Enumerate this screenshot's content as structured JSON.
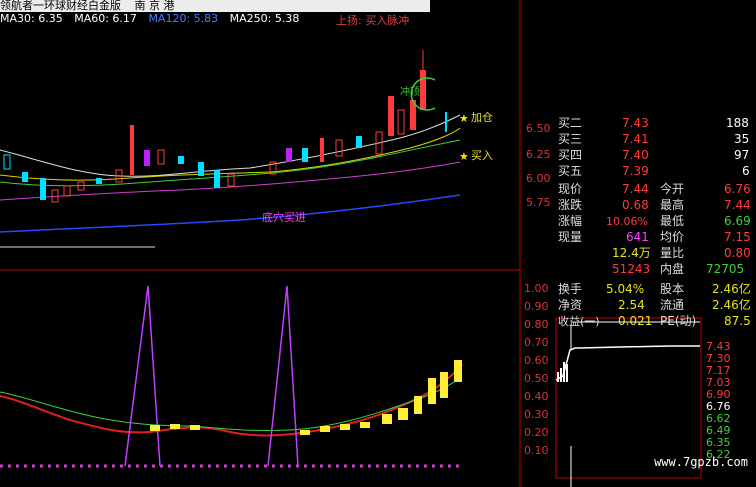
{
  "header": {
    "title": "领航者一环球财经白金版",
    "exchanges": "南 京 港",
    "signal": "上扬: 买入脉冲"
  },
  "ma": [
    {
      "label": "MA30: 6.35",
      "color": "#ffffff"
    },
    {
      "label": "MA60: 6.17",
      "color": "#ffffff"
    },
    {
      "label": "MA120: 5.83",
      "color": "#4a7dff"
    },
    {
      "label": "MA250: 5.38",
      "color": "#ffffff"
    }
  ],
  "annotations": {
    "add_position": "加仓",
    "buy": "买入",
    "bottom_buy": "底穴买进",
    "pulse": "冲顶"
  },
  "price_axis": [
    "6.50",
    "6.25",
    "6.00",
    "5.75"
  ],
  "indicator_axis": [
    "1.00",
    "0.90",
    "0.80",
    "0.70",
    "0.60",
    "0.50",
    "0.40",
    "0.30",
    "0.20",
    "0.10"
  ],
  "quote_partial": [
    {
      "label": "买二",
      "price": "7.43",
      "vol": "188"
    },
    {
      "label": "买三",
      "price": "7.41",
      "vol": "35"
    },
    {
      "label": "买四",
      "price": "7.40",
      "vol": "97"
    },
    {
      "label": "买五",
      "price": "7.39",
      "vol": "6"
    }
  ],
  "quote": {
    "now_label": "现价",
    "now": "7.44",
    "open_label": "今开",
    "open": "6.76",
    "chg_label": "涨跌",
    "chg": "0.68",
    "high_label": "最高",
    "high": "7.44",
    "pct_label": "涨幅",
    "pct": "10.06%",
    "low_label": "最低",
    "low": "6.69",
    "qty_label": "现量",
    "qty": "641",
    "avg_label": "均价",
    "avg": "7.15",
    "amt": "12.4万",
    "ratio_label": "量比",
    "ratio": "0.80",
    "outer": "51243",
    "inner_label": "内盘",
    "inner": "72705",
    "turnover_label": "换手",
    "turnover": "5.04%",
    "equity_label": "股本",
    "equity": "2.46亿",
    "nav_label": "净资",
    "nav": "2.54",
    "float_label": "流通",
    "float": "2.46亿",
    "eps_label": "收益(一)",
    "eps": "0.021",
    "pe_label": "PE(动)",
    "pe": "87.5"
  },
  "mini_axis": [
    "7.43",
    "7.30",
    "7.17",
    "7.03",
    "6.90",
    "6.76",
    "6.62",
    "6.49",
    "6.35",
    "6.22"
  ],
  "watermark": "www.7gpzb.com"
}
